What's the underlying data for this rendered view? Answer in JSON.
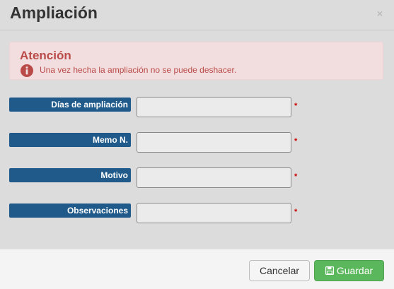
{
  "dialog": {
    "title": "Ampliación",
    "close_glyph": "×"
  },
  "alert": {
    "title": "Atención",
    "message": "Una vez hecha la ampliación no se puede deshacer.",
    "icon": "info-circle-icon",
    "color": "#b94a48"
  },
  "form": {
    "fields": [
      {
        "label": "Días de ampliación",
        "value": "",
        "required": "*"
      },
      {
        "label": "Memo N.",
        "value": "",
        "required": "*"
      },
      {
        "label": "Motivo",
        "value": "",
        "required": "*"
      },
      {
        "label": "Observaciones",
        "value": "",
        "required": "*"
      }
    ],
    "label_color": "#1f5a8b"
  },
  "footer": {
    "cancel_label": "Cancelar",
    "save_label": "Guardar",
    "save_icon": "floppy-disk-icon",
    "save_color": "#5bb75b"
  }
}
